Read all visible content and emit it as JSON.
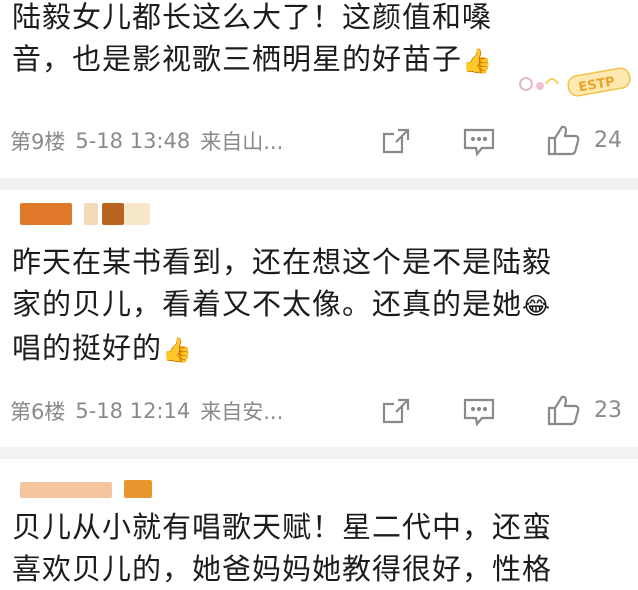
{
  "comments": [
    {
      "text": "陆毅女儿都长这么大了！这颜值和嗓音，也是影视歌三栖明星的好苗子",
      "text_line1": "陆毅女儿都长这么大了！这颜值和嗓",
      "text_line2": "音，也是影视歌三栖明星的好苗子",
      "emoji": "👍",
      "sticker_text": "ESTP",
      "floor": "第9楼",
      "time": "5-18 13:48",
      "source": "来自山...",
      "likes": "24"
    },
    {
      "text_line1": "昨天在某书看到，还在想这个是不是陆毅",
      "text_line2": "家的贝儿，看着又不太像。还真的是她",
      "text_line3": "唱的挺好的",
      "emoji_laugh": "😂",
      "emoji": "👍",
      "floor": "第6楼",
      "time": "5-18 12:14",
      "source": "来自安...",
      "likes": "23"
    },
    {
      "text_line1": "贝儿从小就有唱歌天赋！星二代中，还蛮",
      "text_line2": "喜欢贝儿的，她爸妈妈她教得很好，性格"
    }
  ],
  "icons": {
    "share": "share-icon",
    "comment": "comment-icon",
    "like": "thumbs-up-icon"
  },
  "colors": {
    "meta_gray": "#8a8a8a",
    "divider": "#f2f2f2",
    "avatar_orange": "#e07a2a"
  }
}
